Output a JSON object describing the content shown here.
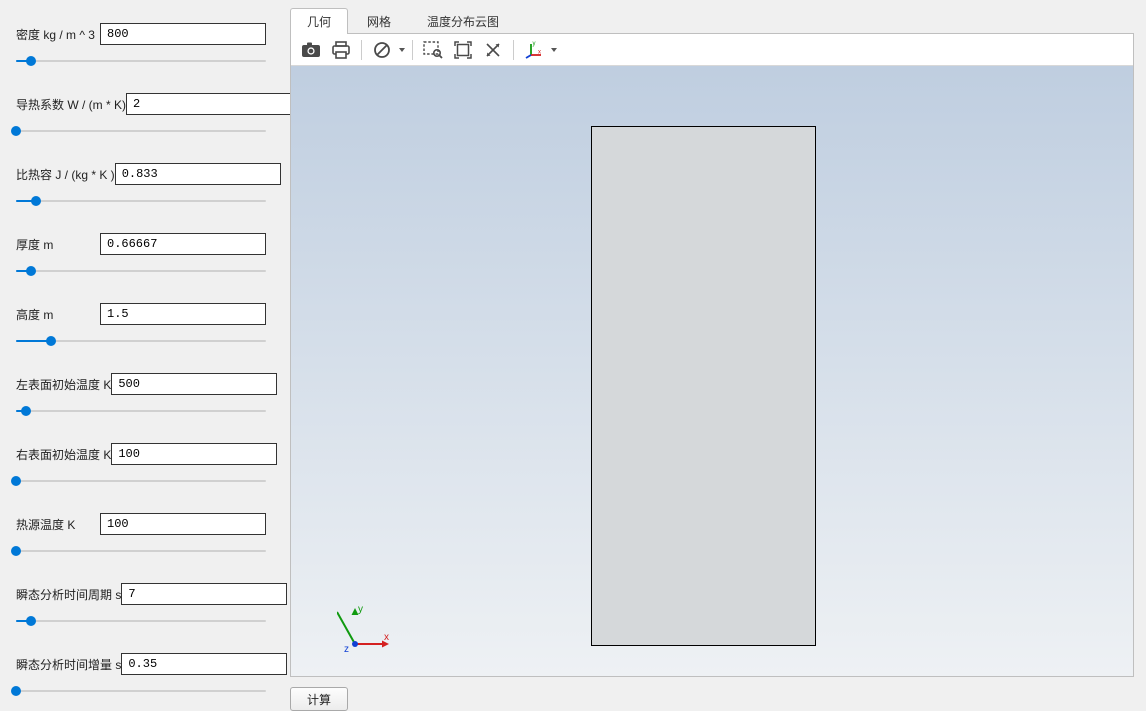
{
  "sidebar": {
    "params": [
      {
        "label": "密度 kg / m ^ 3",
        "value": "800",
        "pos_pct": 6
      },
      {
        "label": "导热系数 W / (m * K)",
        "value": "2",
        "pos_pct": 0
      },
      {
        "label": "比热容 J / (kg * K )",
        "value": "0.833",
        "pos_pct": 8
      },
      {
        "label": "厚度 m",
        "value": "0.66667",
        "pos_pct": 6
      },
      {
        "label": "高度 m",
        "value": "1.5",
        "pos_pct": 14
      },
      {
        "label": "左表面初始温度 K",
        "value": "500",
        "pos_pct": 4
      },
      {
        "label": "右表面初始温度 K",
        "value": "100",
        "pos_pct": 0
      },
      {
        "label": "热源温度  K",
        "value": "100",
        "pos_pct": 0
      },
      {
        "label": "瞬态分析时间周期 s",
        "value": "7",
        "pos_pct": 6
      },
      {
        "label": "瞬态分析时间增量 s",
        "value": "0.35",
        "pos_pct": 0
      }
    ]
  },
  "tabs": {
    "items": [
      "几何",
      "网格",
      "温度分布云图"
    ],
    "active_index": 0
  },
  "toolbar": {
    "camera": "screenshot-icon",
    "print": "print-icon",
    "forbid": "reset-view-icon",
    "zoom_select": "zoom-select-icon",
    "fit": "zoom-extents-icon",
    "rotate": "rotate-icon",
    "axes": "axes-orientation-icon"
  },
  "viewport": {
    "axes": {
      "x": "x",
      "y": "y",
      "z": "z"
    }
  },
  "actions": {
    "calc": "计算"
  }
}
